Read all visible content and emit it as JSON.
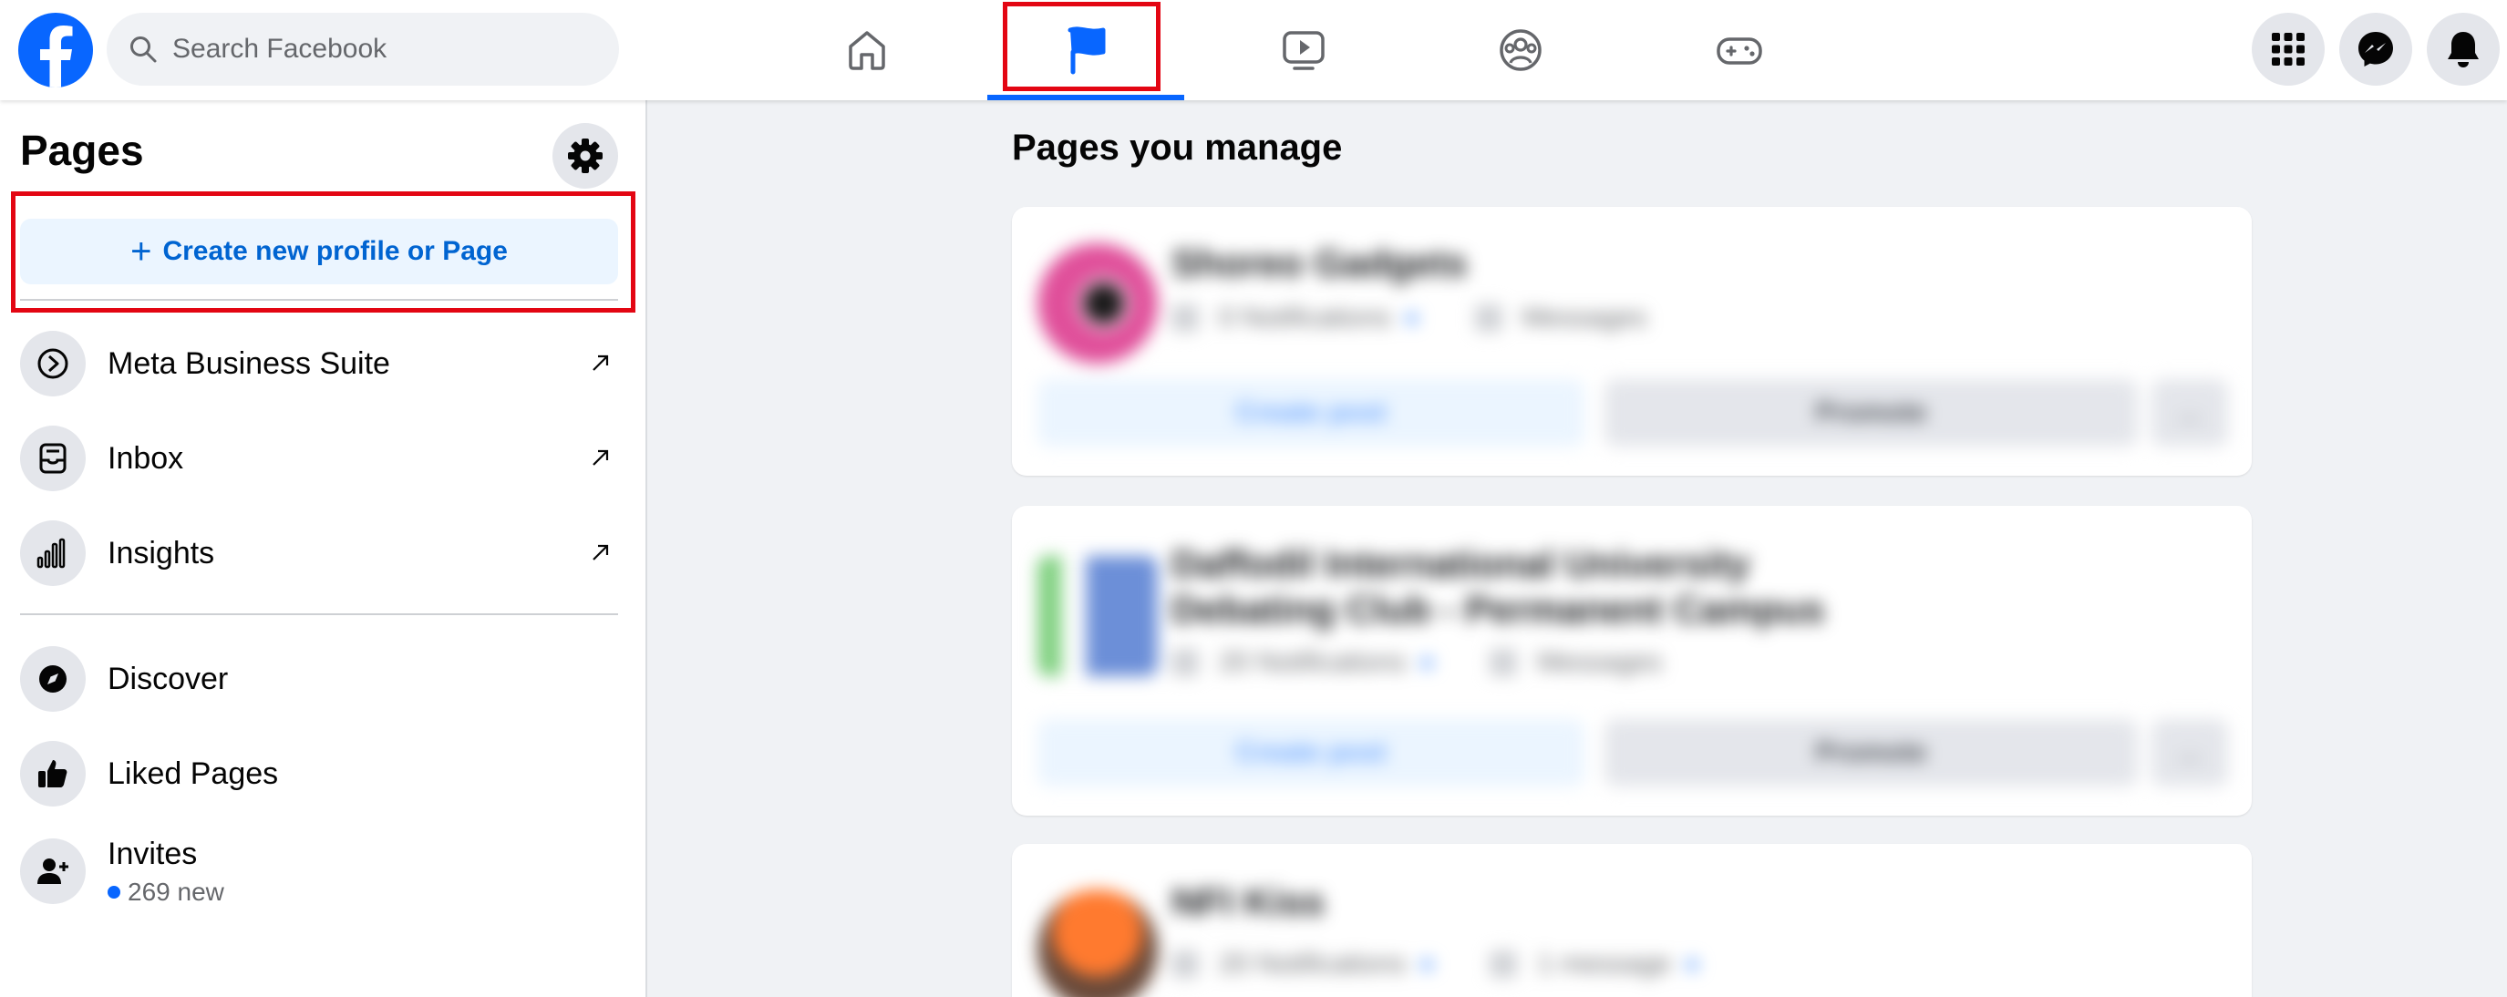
{
  "header": {
    "search_placeholder": "Search Facebook",
    "nav_tabs": [
      "home",
      "pages",
      "watch",
      "groups",
      "gaming"
    ],
    "active_tab": "pages",
    "colors": {
      "brand": "#0866ff",
      "highlight": "#e30613"
    }
  },
  "sidebar": {
    "title": "Pages",
    "create_plus": "+",
    "create_label": "Create new profile or Page",
    "items": [
      {
        "label": "Meta Business Suite",
        "icon": "business-suite-icon"
      },
      {
        "label": "Inbox",
        "icon": "inbox-icon"
      },
      {
        "label": "Insights",
        "icon": "insights-icon"
      },
      {
        "label": "Discover",
        "icon": "compass-icon"
      },
      {
        "label": "Liked Pages",
        "icon": "thumbs-up-icon"
      },
      {
        "label": "Invites",
        "icon": "add-person-icon",
        "sub": "269 new"
      }
    ]
  },
  "main": {
    "heading": "Pages you manage",
    "cards": [
      {
        "name": "Shoreo Gadgets",
        "notifications": "0 Notifications",
        "messages": "Messages",
        "create_post": "Create post",
        "promote": "Promote",
        "more": "..."
      },
      {
        "name": "Daffodil International University",
        "name_line2": "Debating Club - Permanent Campus",
        "notifications": "20 Notifications",
        "messages": "Messages",
        "create_post": "Create post",
        "promote": "Promote",
        "more": "..."
      },
      {
        "name": "NFI Kiss",
        "notifications": "20 Notifications",
        "messages": "1 message"
      }
    ]
  }
}
